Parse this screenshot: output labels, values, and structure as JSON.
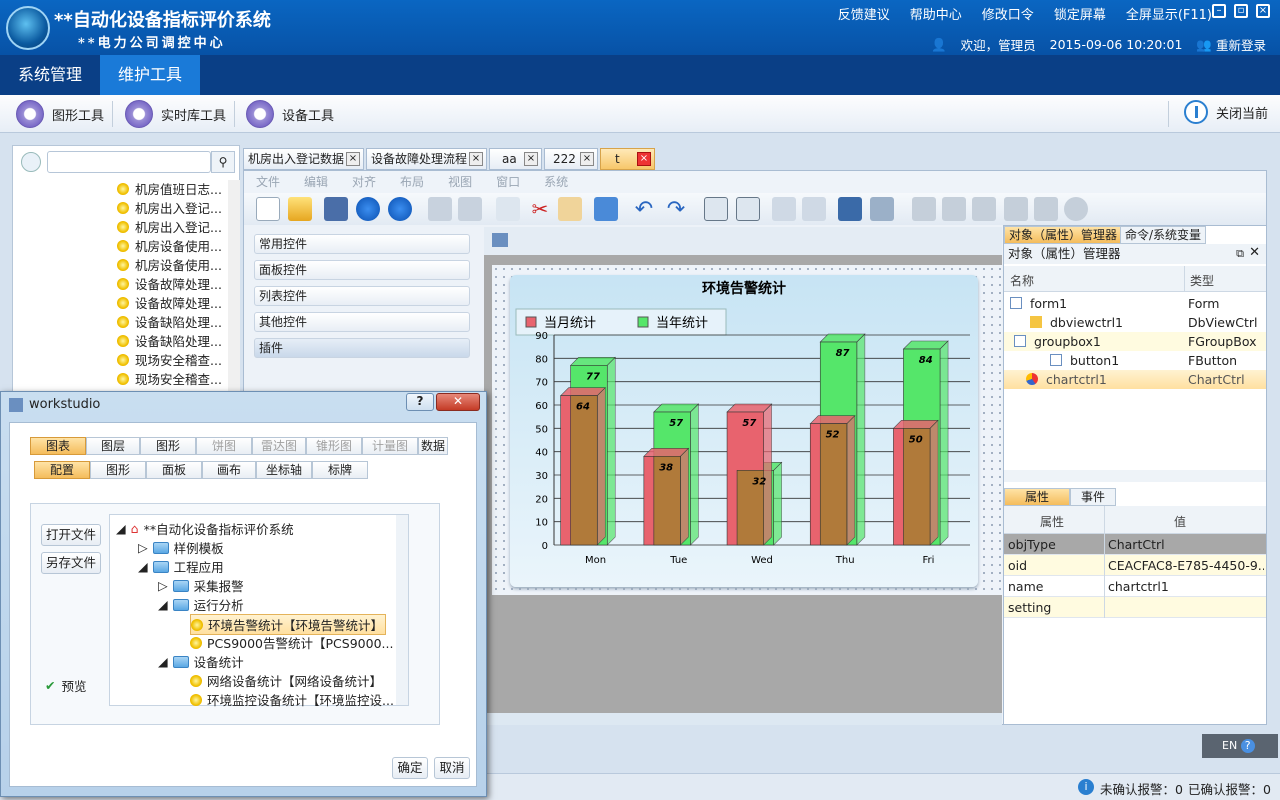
{
  "header": {
    "title": "**自动化设备指标评价系统",
    "subtitle": "**电力公司调控中心",
    "links": [
      "反馈建议",
      "帮助中心",
      "修改口令",
      "锁定屏幕",
      "全屏显示(F11)"
    ],
    "welcome": "欢迎，管理员",
    "datetime": "2015-09-06 10:20:01",
    "relogin": "重新登录"
  },
  "menu": {
    "tabs": [
      "系统管理",
      "维护工具"
    ],
    "active": "维护工具"
  },
  "toolbar": {
    "graphic": "图形工具",
    "realtime": "实时库工具",
    "device": "设备工具",
    "close": "关闭当前"
  },
  "tree": {
    "items": [
      "机房值班日志...",
      "机房出入登记...",
      "机房出入登记...",
      "机房设备使用...",
      "机房设备使用...",
      "设备故障处理...",
      "设备故障处理...",
      "设备缺陷处理...",
      "设备缺陷处理...",
      "现场安全稽查...",
      "现场安全稽查..."
    ]
  },
  "doc_tabs": [
    "机房出入登记数据",
    "设备故障处理流程",
    "aa",
    "222",
    "t"
  ],
  "editor_menu": [
    "文件",
    "编辑",
    "对齐",
    "布局",
    "视图",
    "窗口",
    "系统"
  ],
  "controls": [
    "常用控件",
    "面板控件",
    "列表控件",
    "其他控件",
    "插件"
  ],
  "chart_data": {
    "type": "bar",
    "title": "环境告警统计",
    "categories": [
      "Mon",
      "Tue",
      "Wed",
      "Thu",
      "Fri"
    ],
    "series": [
      {
        "name": "当月统计",
        "values": [
          64,
          38,
          57,
          52,
          50
        ],
        "color": "#e8636e"
      },
      {
        "name": "当年统计",
        "values": [
          77,
          57,
          32,
          87,
          84
        ],
        "color": "#55e66a"
      }
    ],
    "ylim": [
      0,
      90
    ],
    "yticks": [
      0,
      10,
      20,
      30,
      40,
      50,
      60,
      70,
      80,
      90
    ],
    "legend": "top-left",
    "grid": true
  },
  "right_panel": {
    "tab1": "对象（属性）管理器",
    "tab2": "命令/系统变量",
    "panel_title": "对象（属性）管理器",
    "col_name": "名称",
    "col_type": "类型",
    "objects": [
      {
        "name": "form1",
        "type": "Form"
      },
      {
        "name": "dbviewctrl1",
        "type": "DbViewCtrl"
      },
      {
        "name": "groupbox1",
        "type": "FGroupBox"
      },
      {
        "name": "button1",
        "type": "FButton"
      },
      {
        "name": "chartctrl1",
        "type": "ChartCtrl"
      }
    ],
    "ptab1": "属性",
    "ptab2": "事件",
    "pcol1": "属性",
    "pcol2": "值",
    "props": [
      {
        "k": "objType",
        "v": "ChartCtrl"
      },
      {
        "k": "oid",
        "v": "CEACFAC8-E785-4450-9..."
      },
      {
        "k": "name",
        "v": "chartctrl1"
      },
      {
        "k": "setting",
        "v": ""
      }
    ]
  },
  "dialog": {
    "title": "workstudio",
    "tabs1": [
      "图表",
      "图层",
      "图形",
      "饼图",
      "雷达图",
      "锥形图",
      "计量图",
      "数据"
    ],
    "tabs2": [
      "配置",
      "图形",
      "面板",
      "画布",
      "坐标轴",
      "标牌"
    ],
    "open": "打开文件",
    "saveas": "另存文件",
    "preview": "预览",
    "ok": "确定",
    "cancel": "取消",
    "tree": {
      "root": "**自动化设备指标评价系统",
      "n1": "样例模板",
      "n2": "工程应用",
      "n3": "采集报警",
      "n4": "运行分析",
      "n5": "环境告警统计【环境告警统计】",
      "n6": "PCS9000告警统计【PCS9000...",
      "n7": "设备统计",
      "n8": "网络设备统计【网络设备统计】",
      "n9": "环境监控设备统计【环境监控设..."
    }
  },
  "ime": "EN",
  "status": {
    "unconfirmed": "未确认报警：0",
    "confirmed": "已确认报警：0"
  }
}
